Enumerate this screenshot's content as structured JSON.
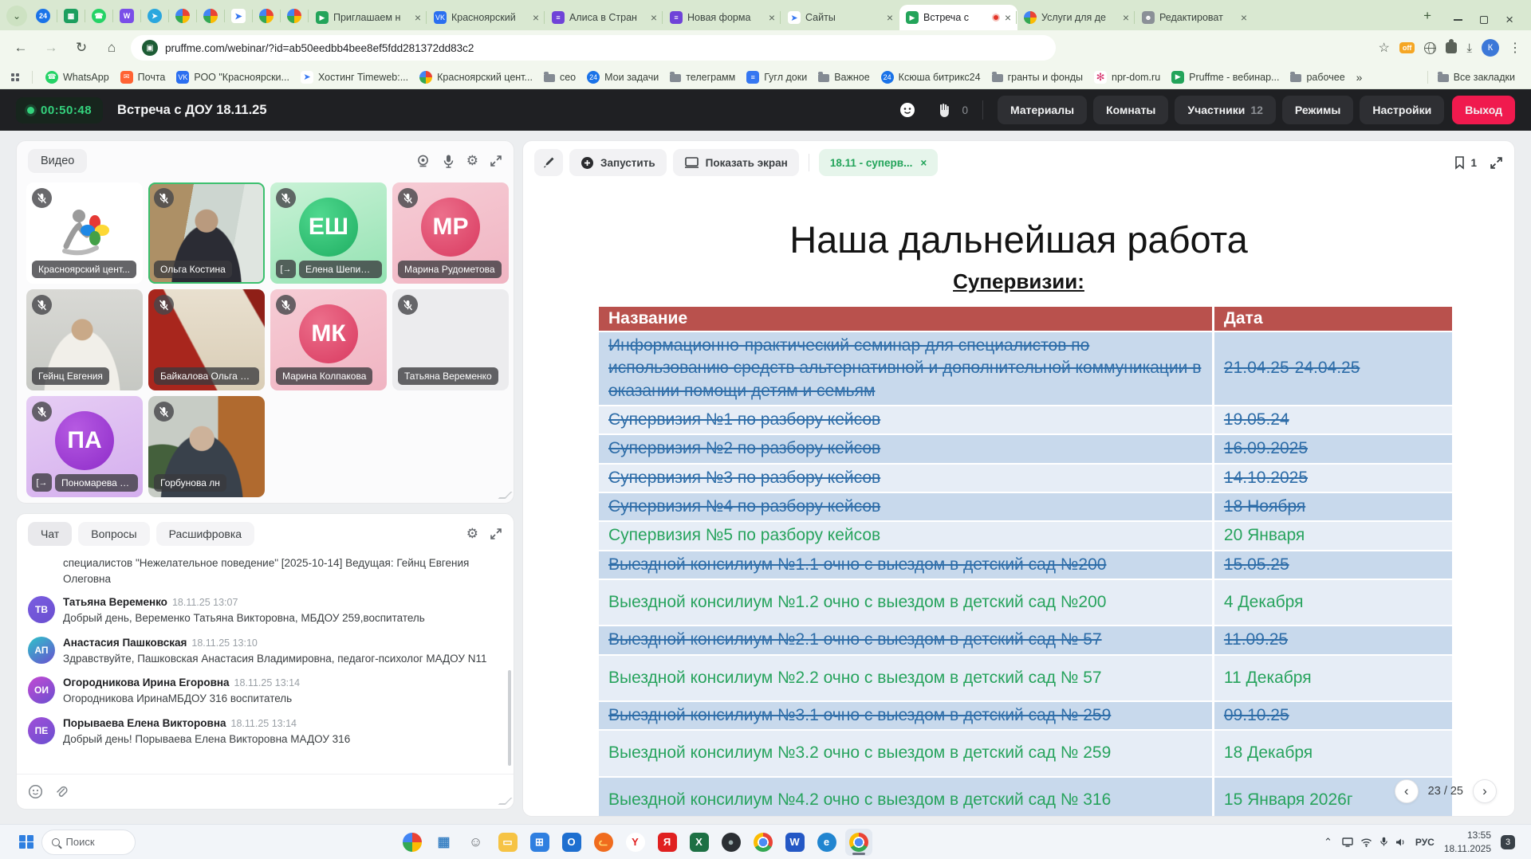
{
  "browser": {
    "pinned_tabs": [
      {
        "name": "pinned-bitrix24",
        "icon": "b24"
      },
      {
        "name": "pinned-sheets",
        "icon": "sheets"
      },
      {
        "name": "pinned-whatsapp",
        "icon": "whatsapp"
      },
      {
        "name": "pinned-wand",
        "icon": "wand"
      },
      {
        "name": "pinned-telegram",
        "icon": "telegram"
      },
      {
        "name": "pinned-flower",
        "icon": "pinwheel"
      },
      {
        "name": "pinned-photos",
        "icon": "pinwheel"
      },
      {
        "name": "pinned-timeweb",
        "icon": "arrow"
      },
      {
        "name": "pinned-photos-2",
        "icon": "pinwheel"
      },
      {
        "name": "pinned-photos-3",
        "icon": "pinwheel"
      }
    ],
    "tabs": [
      {
        "label": "Приглашаем н",
        "icon": "pruffme",
        "active": false,
        "recording": false
      },
      {
        "label": "Красноярский",
        "icon": "vk",
        "active": false,
        "recording": false
      },
      {
        "label": "Алиса в Стран",
        "icon": "forms",
        "active": false,
        "recording": false
      },
      {
        "label": "Новая форма",
        "icon": "forms",
        "active": false,
        "recording": false
      },
      {
        "label": "Сайты",
        "icon": "arrow",
        "active": false,
        "recording": false
      },
      {
        "label": "Встреча с",
        "icon": "pruffme",
        "active": true,
        "recording": true
      },
      {
        "label": "Услуги для де",
        "icon": "pinwheel",
        "active": false,
        "recording": false
      },
      {
        "label": "Редактироват",
        "icon": "person",
        "active": false,
        "recording": false
      }
    ],
    "new_tab_button": "+",
    "close_glyph": "×",
    "url": "pruffme.com/webinar/?id=ab50eedbb4bee8ef5fdd281372dd83c2",
    "extension_badge": "off",
    "bookmarks": [
      {
        "icon": "whatsapp",
        "label": "WhatsApp"
      },
      {
        "icon": "mail",
        "label": "Почта"
      },
      {
        "icon": "vk",
        "label": "РОО \"Красноярски..."
      },
      {
        "icon": "arrow",
        "label": "Хостинг Timeweb:..."
      },
      {
        "icon": "pinwheel",
        "label": "Красноярский цент..."
      },
      {
        "icon": "folder",
        "label": "сео"
      },
      {
        "icon": "b24",
        "label": "Мои задачи"
      },
      {
        "icon": "folder",
        "label": "телеграмм"
      },
      {
        "icon": "docs",
        "label": "Гугл доки"
      },
      {
        "icon": "folder",
        "label": "Важное"
      },
      {
        "icon": "b24",
        "label": "Ксюша битрикс24"
      },
      {
        "icon": "folder",
        "label": "гранты и фонды"
      },
      {
        "icon": "npr",
        "label": "npr-dom.ru"
      },
      {
        "icon": "pruffme",
        "label": "Pruffme - вебинар..."
      },
      {
        "icon": "folder",
        "label": "рабочее"
      }
    ],
    "bookmarks_overflow": "»",
    "all_bookmarks_label": "Все закладки"
  },
  "webinar": {
    "timer": "00:50:48",
    "title": "Встреча с ДОУ 18.11.25",
    "hand_count": "0",
    "nav": [
      {
        "label": "Материалы",
        "badge": ""
      },
      {
        "label": "Комнаты",
        "badge": ""
      },
      {
        "label": "Участники",
        "badge": "12"
      },
      {
        "label": "Режимы",
        "badge": ""
      },
      {
        "label": "Настройки",
        "badge": ""
      }
    ],
    "exit_label": "Выход"
  },
  "video_panel": {
    "label": "Видео",
    "tiles": [
      {
        "kind": "logo",
        "name": "Красноярский цент...",
        "exit": false,
        "active": false
      },
      {
        "kind": "video",
        "scene": "olga",
        "name": "Ольга Костина",
        "exit": false,
        "active": true
      },
      {
        "kind": "avatar",
        "theme": "green",
        "initials": "ЕШ",
        "name": "Елена Шепило...",
        "exit": true,
        "active": false
      },
      {
        "kind": "avatar",
        "theme": "pink",
        "initials": "МР",
        "name": "Марина Рудометова",
        "exit": false,
        "active": false
      },
      {
        "kind": "video",
        "scene": "geints",
        "name": "Гейнц Евгения",
        "exit": false,
        "active": false
      },
      {
        "kind": "video",
        "scene": "baikalova",
        "name": "Байкалова Ольга Ил...",
        "exit": false,
        "active": false
      },
      {
        "kind": "avatar",
        "theme": "pink",
        "initials": "МК",
        "name": "Марина Колпакова",
        "exit": false,
        "active": false
      },
      {
        "kind": "empty",
        "theme": "empty",
        "name": "Татьяна Веременко",
        "exit": false,
        "active": false
      },
      {
        "kind": "avatar",
        "theme": "purple",
        "initials": "ПА",
        "name": "Пономарева А...",
        "exit": true,
        "active": false
      },
      {
        "kind": "video",
        "scene": "gorbunova",
        "name": "Горбунова лн",
        "exit": false,
        "active": false
      }
    ]
  },
  "chat": {
    "tabs": [
      {
        "label": "Чат",
        "active": true
      },
      {
        "label": "Вопросы",
        "active": false
      },
      {
        "label": "Расшифровка",
        "active": false
      }
    ],
    "messages": [
      {
        "continuation": true,
        "text": "специалистов \"Нежелательное поведение\" [2025-10-14] Ведущая: Гейнц Евгения Олеговна"
      },
      {
        "initials": "ТВ",
        "color": "#7a5de0",
        "name": "Татьяна Веременко",
        "time": "18.11.25 13:07",
        "text": "Добрый день, Веременко Татьяна Викторовна, МБДОУ 259,воспитатель"
      },
      {
        "initials": "АП",
        "color": "#2cc5c9",
        "name": "Анастасия Пашковская",
        "time": "18.11.25 13:10",
        "text": "Здравствуйте, Пашковская Анастасия Владимировна, педагог-психолог МАДОУ N11"
      },
      {
        "initials": "ОИ",
        "color": "#c44ad3",
        "name": "Огородникова Ирина Егоровна",
        "time": "18.11.25 13:14",
        "text": "Огородникова ИринаМБДОУ 316 воспитатель"
      },
      {
        "initials": "ПЕ",
        "color": "#a14fd8",
        "name": "Порываева Елена Викторовна",
        "time": "18.11.25 13:14",
        "text": "Добрый день! Порываева Елена Викторовна МАДОУ 316"
      }
    ]
  },
  "presentation": {
    "toolbar": {
      "run_label": "Запустить",
      "share_label": "Показать экран",
      "doc_tab_label": "18.11 - суперв...",
      "doc_tab_close": "×",
      "bookmark_count": "1"
    },
    "slide": {
      "title": "Наша дальнейшая работа",
      "subtitle": "Супервизии:",
      "table": {
        "headers": [
          "Название",
          "Дата"
        ],
        "rows": [
          {
            "name": "Информационно-практический семинар для специалистов по использованию средств альтернативной и дополнительной коммуникации в оказании помощи детям и семьям",
            "date": "21.04.25-24.04.25",
            "done": true,
            "tall": false
          },
          {
            "name": "Супервизия №1  по разбору кейсов",
            "date": "19.05.24",
            "done": true,
            "tall": false
          },
          {
            "name": "Супервизия №2 по разбору кейсов",
            "date": "16.09.2025",
            "done": true,
            "tall": false
          },
          {
            "name": "Супервизия №3 по разбору кейсов",
            "date": "14.10.2025",
            "done": true,
            "tall": false
          },
          {
            "name": "Супервизия №4 по разбору кейсов",
            "date": "18 Ноября",
            "done": true,
            "tall": false
          },
          {
            "name": "Супервизия №5 по разбору кейсов",
            "date": "20 Января",
            "done": false,
            "tall": false
          },
          {
            "name": "Выездной консилиум №1.1 очно с выездом в детский сад №200",
            "date": "15.05.25",
            "done": true,
            "tall": false
          },
          {
            "name": "Выездной консилиум №1.2 очно с выездом в детский сад №200",
            "date": "4 Декабря",
            "done": false,
            "tall": true
          },
          {
            "name": "Выездной консилиум №2.1 очно с выездом в детский сад № 57",
            "date": "11.09.25",
            "done": true,
            "tall": false
          },
          {
            "name": "Выездной консилиум №2.2 очно с выездом в детский сад № 57",
            "date": "11 Декабря",
            "done": false,
            "tall": true
          },
          {
            "name": "Выездной консилиум №3.1 очно с выездом в детский сад № 259",
            "date": "09.10.25",
            "done": true,
            "tall": false
          },
          {
            "name": "Выездной консилиум №3.2 очно с выездом в детский сад № 259",
            "date": "18 Декабря",
            "done": false,
            "tall": true
          },
          {
            "name": "Выездной консилиум №4.2 очно с выездом в детский сад № 316",
            "date": "15 Января 2026г",
            "done": false,
            "tall": true
          }
        ]
      }
    },
    "pagination": {
      "prev": "‹",
      "label": "23 / 25",
      "next": "›"
    }
  },
  "taskbar": {
    "search_placeholder": "Поиск",
    "apps": [
      {
        "name": "copilot",
        "icon": "pinwheel",
        "glyph": ""
      },
      {
        "name": "task-view",
        "icon": "plain",
        "glyph": "▦",
        "bg": "transparent",
        "fg": "#3b82c4"
      },
      {
        "name": "people",
        "icon": "plain",
        "glyph": "☺",
        "bg": "transparent",
        "fg": "#5f6368"
      },
      {
        "name": "file-explorer",
        "icon": "box",
        "glyph": "▭",
        "bg": "#f6c344",
        "fg": "#fff"
      },
      {
        "name": "store",
        "icon": "box",
        "glyph": "⊞",
        "bg": "#2f7fe0",
        "fg": "#fff"
      },
      {
        "name": "outlook",
        "icon": "box",
        "glyph": "O",
        "bg": "#1e6fd0",
        "fg": "#fff"
      },
      {
        "name": "firefox",
        "icon": "ball",
        "glyph": "ᓚ",
        "bg": "#f06c1e",
        "fg": "#ffd56b"
      },
      {
        "name": "y-app",
        "icon": "ball",
        "glyph": "Y",
        "bg": "#ffffff",
        "fg": "#e02020"
      },
      {
        "name": "yandex-browser",
        "icon": "box",
        "glyph": "Я",
        "bg": "#e02020",
        "fg": "#fff"
      },
      {
        "name": "excel",
        "icon": "box",
        "glyph": "X",
        "bg": "#1d7044",
        "fg": "#fff"
      },
      {
        "name": "dark-app",
        "icon": "ball",
        "glyph": "●",
        "bg": "#2b2f33",
        "fg": "#9aa"
      },
      {
        "name": "chrome",
        "icon": "chrome",
        "glyph": ""
      },
      {
        "name": "word",
        "icon": "box",
        "glyph": "W",
        "bg": "#2458c5",
        "fg": "#fff"
      },
      {
        "name": "edge",
        "icon": "ball",
        "glyph": "e",
        "bg": "#2185d0",
        "fg": "#fff"
      },
      {
        "name": "chrome-active",
        "icon": "chrome",
        "glyph": "",
        "active": true
      }
    ],
    "tray": {
      "lang": "РУС",
      "time": "13:55",
      "date": "18.11.2025",
      "badge": "3"
    }
  }
}
